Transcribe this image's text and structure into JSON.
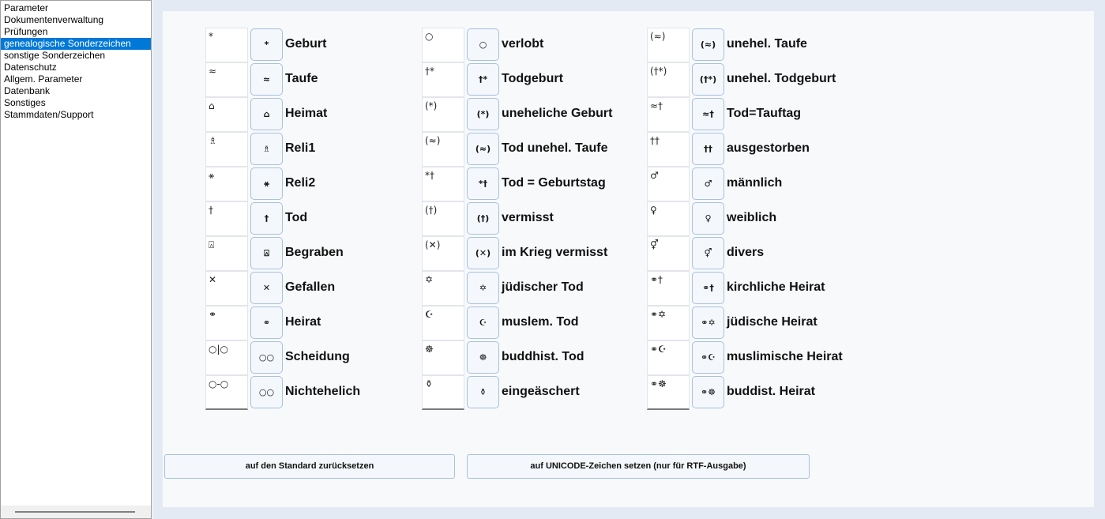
{
  "sidebar": {
    "items": [
      {
        "label": "Parameter"
      },
      {
        "label": "Dokumentenverwaltung"
      },
      {
        "label": "Prüfungen"
      },
      {
        "label": "genealogische Sonderzeichen",
        "selected": true
      },
      {
        "label": "sonstige Sonderzeichen"
      },
      {
        "label": "Datenschutz"
      },
      {
        "label": "Allgem. Parameter"
      },
      {
        "label": "Datenbank"
      },
      {
        "label": "Sonstiges"
      },
      {
        "label": "Stammdaten/Support"
      }
    ]
  },
  "columns": [
    [
      {
        "symbol": "*",
        "button": "*",
        "label": "Geburt"
      },
      {
        "symbol": "≈",
        "button": "≈",
        "label": "Taufe"
      },
      {
        "symbol": "⌂",
        "button": "⌂",
        "label": "Heimat"
      },
      {
        "symbol": "♗",
        "button": "♗",
        "label": "Reli1"
      },
      {
        "symbol": "⚹",
        "button": "⚹",
        "label": "Reli2"
      },
      {
        "symbol": "†",
        "button": "†",
        "label": "Tod"
      },
      {
        "symbol": "⍓",
        "button": "⍓",
        "label": "Begraben"
      },
      {
        "symbol": "✕",
        "button": "✕",
        "label": "Gefallen"
      },
      {
        "symbol": "⚭",
        "button": "⚭",
        "label": "Heirat"
      },
      {
        "symbol": "○|○",
        "button": "○○",
        "label": "Scheidung"
      },
      {
        "symbol": "○-○",
        "button": "○○",
        "label": "Nichtehelich"
      }
    ],
    [
      {
        "symbol": "○",
        "button": "○",
        "label": "verlobt"
      },
      {
        "symbol": "†*",
        "button": "†*",
        "label": "Todgeburt"
      },
      {
        "symbol": "(*)",
        "button": "(*)",
        "label": "uneheliche Geburt"
      },
      {
        "symbol": "(≈)",
        "button": "(≈)",
        "label": "Tod unehel. Taufe"
      },
      {
        "symbol": "*†",
        "button": "*†",
        "label": "Tod = Geburtstag"
      },
      {
        "symbol": "(†)",
        "button": "(†)",
        "label": "vermisst"
      },
      {
        "symbol": "(✕)",
        "button": "(✕)",
        "label": "im Krieg vermisst"
      },
      {
        "symbol": "✡",
        "button": "✡",
        "label": "jüdischer Tod"
      },
      {
        "symbol": "☪",
        "button": "☪",
        "label": "muslem. Tod"
      },
      {
        "symbol": "☸",
        "button": "☸",
        "label": "buddhist. Tod"
      },
      {
        "symbol": "⚱",
        "button": "⚱",
        "label": "eingeäschert"
      }
    ],
    [
      {
        "symbol": "(≈)",
        "button": "(≈)",
        "label": "unehel. Taufe"
      },
      {
        "symbol": "(†*)",
        "button": "(†*)",
        "label": "unehel. Todgeburt"
      },
      {
        "symbol": "≈†",
        "button": "≈†",
        "label": "Tod=Tauftag"
      },
      {
        "symbol": "††",
        "button": "††",
        "label": "ausgestorben"
      },
      {
        "symbol": "♂",
        "button": "♂",
        "label": "männlich"
      },
      {
        "symbol": "♀",
        "button": "♀",
        "label": "weiblich"
      },
      {
        "symbol": "⚥",
        "button": "⚥",
        "label": "divers"
      },
      {
        "symbol": "⚭†",
        "button": "⚭†",
        "label": "kirchliche Heirat"
      },
      {
        "symbol": "⚭✡",
        "button": "⚭✡",
        "label": "jüdische Heirat"
      },
      {
        "symbol": "⚭☪",
        "button": "⚭☪",
        "label": "muslimische Heirat"
      },
      {
        "symbol": "⚭☸",
        "button": "⚭☸",
        "label": "buddist. Heirat"
      }
    ]
  ],
  "buttons": {
    "reset": "auf den Standard zurücksetzen",
    "unicode": "auf UNICODE-Zeichen setzen (nur für RTF-Ausgabe)"
  }
}
